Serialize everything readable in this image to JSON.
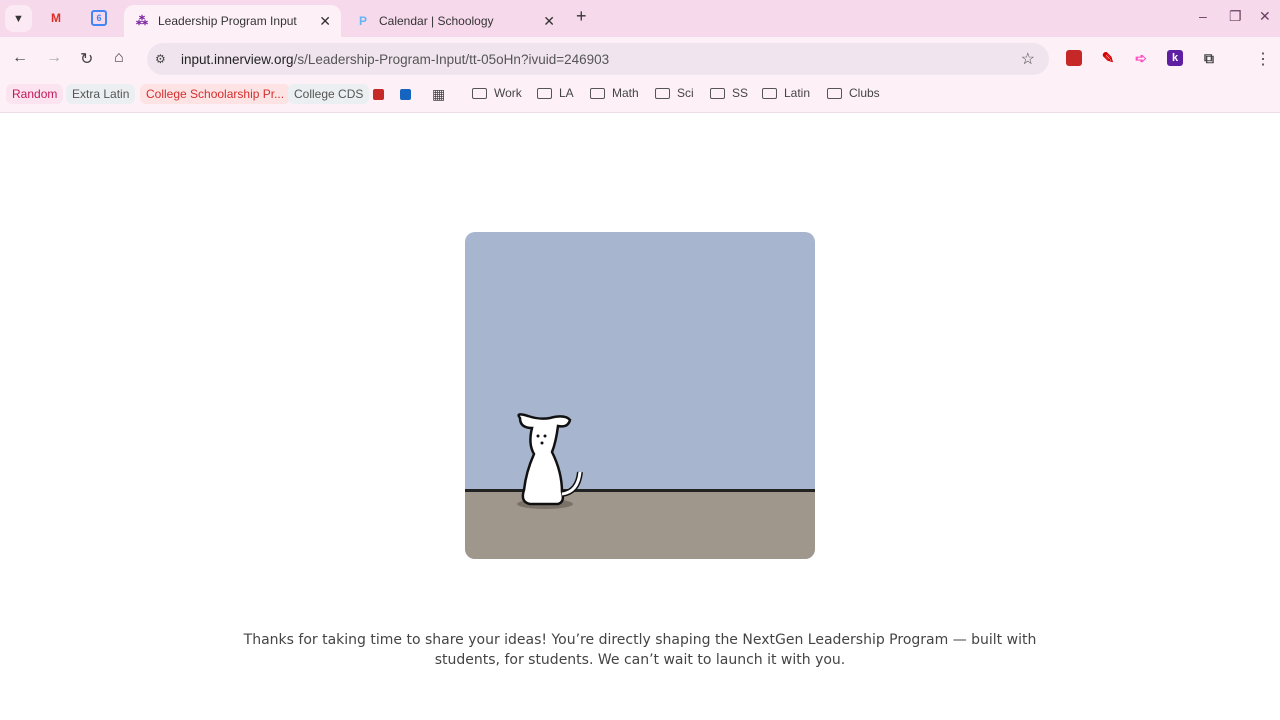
{
  "tabs": [
    {
      "title": "Leadership Program Input",
      "active": true
    },
    {
      "title": "Calendar | Schoology",
      "active": false
    }
  ],
  "pinned_tabs": [
    "Gmail",
    "Google Calendar"
  ],
  "calendar_day": "6",
  "address_bar": {
    "domain": "input.innerview.org",
    "path": "/s/Leadership-Program-Input/tt-05oHn?ivuid=246903"
  },
  "bookmarks": {
    "chips": [
      {
        "label": "Random",
        "color": "#c2185b",
        "bg": "#fbe3ef"
      },
      {
        "label": "Extra Latin",
        "color": "#555555",
        "bg": "#eceff1"
      },
      {
        "label": "College Schoolarship Pr...",
        "color": "#d32f2f",
        "bg": "#fde3e3"
      },
      {
        "label": "College CDS",
        "color": "#555555",
        "bg": "#eceff1"
      }
    ],
    "folders": [
      "Work",
      "LA",
      "Math",
      "Sci",
      "SS",
      "Latin",
      "Clubs"
    ]
  },
  "extensions": {
    "k_label": "k"
  },
  "message": "Thanks for taking  time to share your ideas! You’re directly shaping the NextGen Leadership Program — built with students, for students. We can’t wait to launch it with you."
}
